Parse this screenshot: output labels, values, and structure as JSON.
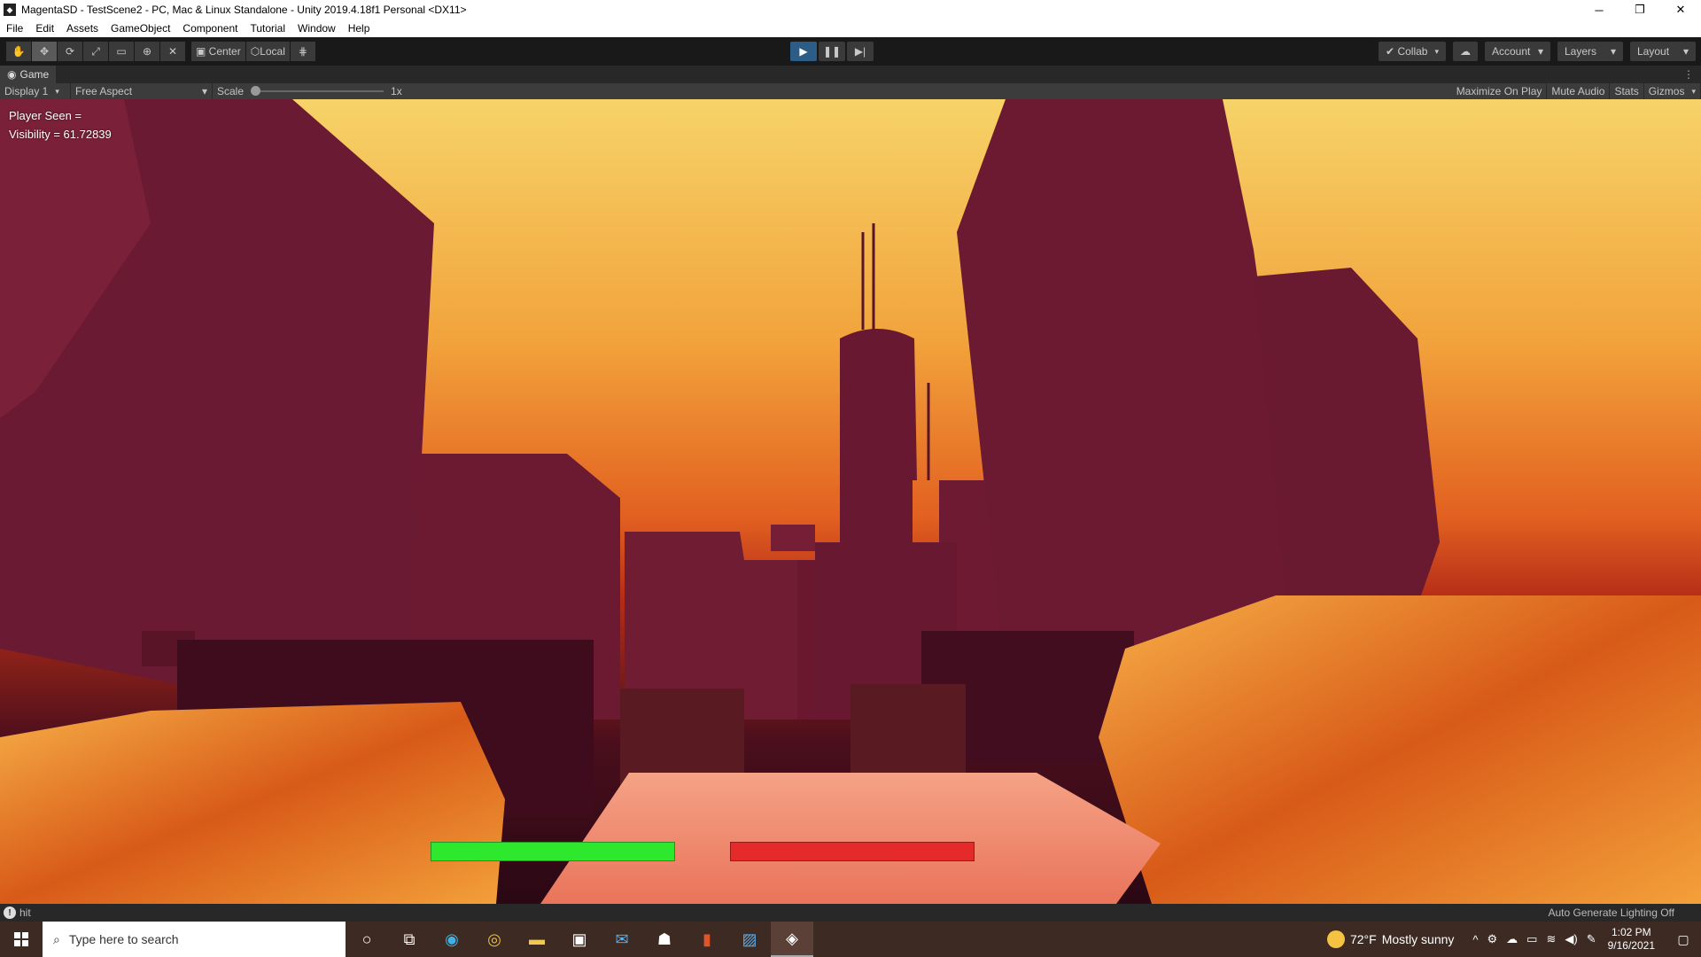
{
  "window": {
    "title": "MagentaSD - TestScene2 - PC, Mac & Linux Standalone - Unity 2019.4.18f1 Personal <DX11>",
    "minimize": "─",
    "restore": "❐",
    "close": "✕"
  },
  "menu": [
    "File",
    "Edit",
    "Assets",
    "GameObject",
    "Component",
    "Tutorial",
    "Window",
    "Help"
  ],
  "toolbar": {
    "pivot_mode": "Center",
    "pivot_rotation": "Local",
    "collab": "Collab",
    "account": "Account",
    "layers": "Layers",
    "layout": "Layout"
  },
  "game_view": {
    "tab_label": "Game",
    "display": "Display 1",
    "aspect": "Free Aspect",
    "scale_label": "Scale",
    "scale_value": "1x",
    "scale_fraction": 0.0,
    "maximize_on_play": "Maximize On Play",
    "mute_audio": "Mute Audio",
    "stats": "Stats",
    "gizmos": "Gizmos"
  },
  "hud": {
    "player_seen": "Player Seen =",
    "visibility": "Visibility = 61.72839",
    "health_bar_color": "#2de82d",
    "enemy_bar_color": "#e52a2a",
    "health_fill": 1.0,
    "enemy_fill": 1.0
  },
  "status": {
    "message": "hit",
    "lighting": "Auto Generate Lighting Off"
  },
  "taskbar": {
    "search_placeholder": "Type here to search",
    "weather_temp": "72°F",
    "weather_desc": "Mostly sunny",
    "time": "1:02 PM",
    "date": "9/16/2021",
    "apps": [
      "cortana-icon",
      "task-view-icon",
      "edge-icon",
      "chrome-icon",
      "file-explorer-icon",
      "store-icon",
      "mail-icon",
      "alienware-icon",
      "office-icon",
      "photos-icon",
      "unity-icon"
    ]
  },
  "colors": {
    "sky_top": "#f6d368",
    "sky_horizon": "#e26020",
    "building": "#6a1830",
    "play_button": "#2c5d87"
  }
}
